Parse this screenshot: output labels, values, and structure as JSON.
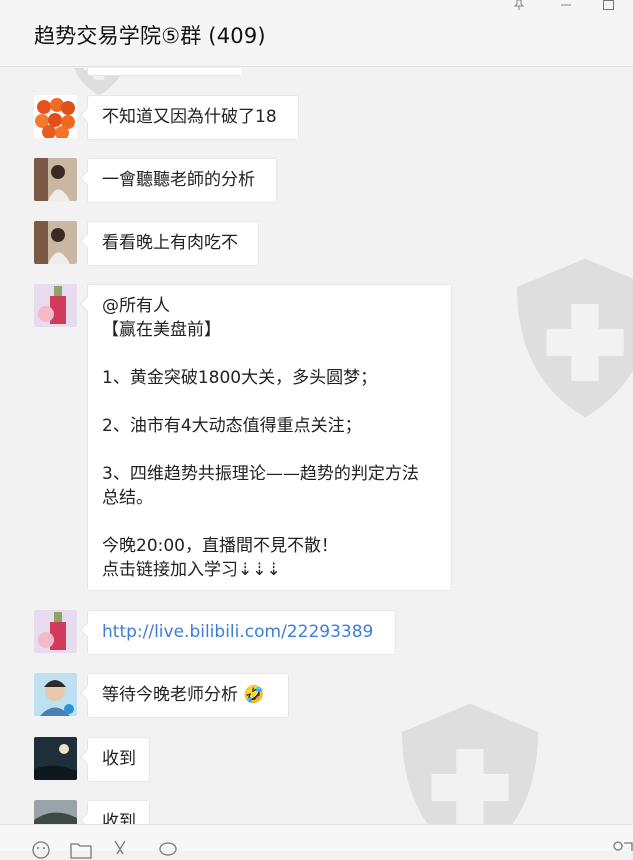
{
  "window": {
    "title": "趋势交易学院⑤群 (409)"
  },
  "messages": [
    {
      "avatar": "orange-balls-avatar",
      "text": "不知道又因為什破了18"
    },
    {
      "avatar": "girl-portrait-avatar",
      "text": "一會聽聽老師的分析"
    },
    {
      "avatar": "girl-portrait-avatar",
      "text": "看看晚上有肉吃不"
    },
    {
      "avatar": "bottle-avatar",
      "lines": [
        "@所有人",
        "【赢在美盘前】",
        "",
        "1、黄金突破1800大关，多头圆梦；",
        "",
        "2、油市有4大动态值得重点关注；",
        "",
        "3、四维趋势共振理论——趋势的判定方法",
        "总结。",
        "",
        "今晚20:00，直播間不見不散！",
        "点击链接加入学习⇣⇣⇣"
      ]
    },
    {
      "avatar": "bottle-avatar",
      "text": "http://live.bilibili.com/22293389",
      "is_link": true
    },
    {
      "avatar": "guy-selfie-avatar",
      "text": "等待今晚老师分析 🤣"
    },
    {
      "avatar": "moon-sky-avatar",
      "text": "收到"
    },
    {
      "avatar": "landscape-avatar",
      "text": "收到"
    }
  ],
  "colors": {
    "link": "#3b7dd8",
    "bubble_bg": "#ffffff",
    "chat_bg": "#f2f2f2"
  }
}
